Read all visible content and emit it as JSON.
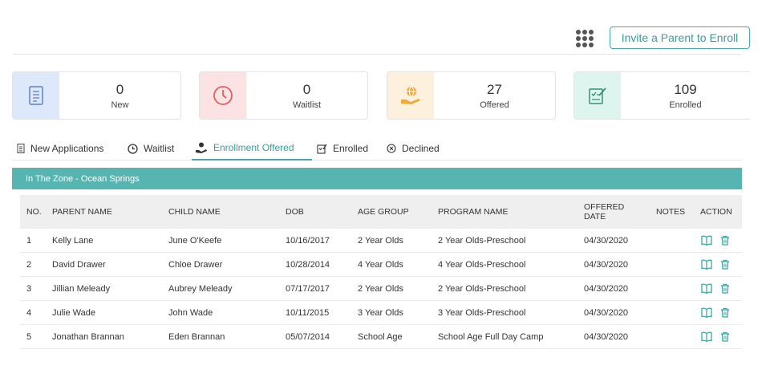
{
  "header": {
    "invite_label": "Invite a Parent to Enroll"
  },
  "stats": [
    {
      "value": "0",
      "label": "New",
      "icon": "document-icon",
      "color": "#dde9fb"
    },
    {
      "value": "0",
      "label": "Waitlist",
      "icon": "clock-icon",
      "color": "#fbe2e3"
    },
    {
      "value": "27",
      "label": "Offered",
      "icon": "offer-hand-icon",
      "color": "#fdf0dc"
    },
    {
      "value": "109",
      "label": "Enrolled",
      "icon": "form-check-icon",
      "color": "#ddf5ee"
    }
  ],
  "tabs": [
    {
      "label": "New Applications",
      "icon": "document-icon"
    },
    {
      "label": "Waitlist",
      "icon": "clock-icon"
    },
    {
      "label": "Enrollment Offered",
      "icon": "person-hand-icon",
      "active": true
    },
    {
      "label": "Enrolled",
      "icon": "form-check-icon"
    },
    {
      "label": "Declined",
      "icon": "x-circle-icon"
    }
  ],
  "zone_title": "In The Zone - Ocean Springs",
  "table": {
    "headers": [
      "NO.",
      "PARENT NAME",
      "CHILD NAME",
      "DOB",
      "AGE GROUP",
      "PROGRAM NAME",
      "OFFERED DATE",
      "NOTES",
      "ACTION"
    ],
    "rows": [
      [
        "1",
        "Kelly Lane",
        "June O'Keefe",
        "10/16/2017",
        "2 Year Olds",
        "2 Year Olds-Preschool",
        "04/30/2020"
      ],
      [
        "2",
        "David Drawer",
        "Chloe Drawer",
        "10/28/2014",
        "4 Year Olds",
        "4 Year Olds-Preschool",
        "04/30/2020"
      ],
      [
        "3",
        "Jillian Meleady",
        "Aubrey Meleady",
        "07/17/2017",
        "2 Year Olds",
        "2 Year Olds-Preschool",
        "04/30/2020"
      ],
      [
        "4",
        "Julie Wade",
        "John Wade",
        "10/11/2015",
        "3 Year Olds",
        "3 Year Olds-Preschool",
        "04/30/2020"
      ],
      [
        "5",
        "Jonathan Brannan",
        "Eden Brannan",
        "05/07/2014",
        "School Age",
        "School Age Full Day Camp",
        "04/30/2020"
      ]
    ]
  },
  "colors": {
    "accent": "#4aa9a6",
    "zone_bar": "#57b5b1"
  }
}
